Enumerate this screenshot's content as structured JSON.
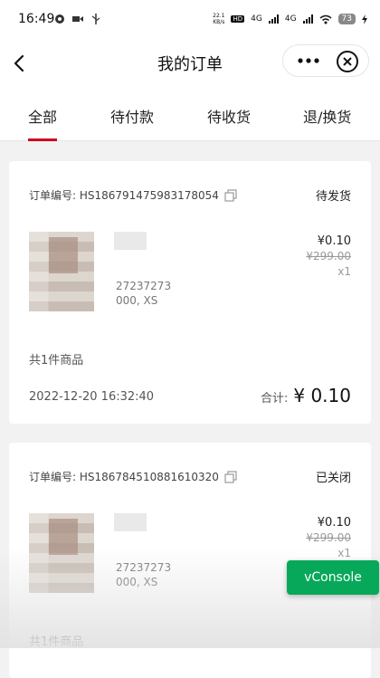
{
  "status_bar": {
    "time": "16:49",
    "net_speed_value": "22.1",
    "net_speed_unit": "KB/s",
    "hd_label": "HD",
    "signal_1": "4G",
    "signal_2": "4G",
    "battery": "73"
  },
  "nav": {
    "title": "我的订单",
    "more_label": "•••"
  },
  "tabs": [
    {
      "label": "全部",
      "active": true
    },
    {
      "label": "待付款",
      "active": false
    },
    {
      "label": "待收货",
      "active": false
    },
    {
      "label": "退/换货",
      "active": false
    }
  ],
  "orders": [
    {
      "order_no": "订单编号: HS186791475983178054",
      "status": "待发货",
      "spec_line_1": "27237273",
      "spec_line_2": "000, XS",
      "price": "¥0.10",
      "original_price": "¥299.00",
      "quantity": "x1",
      "item_count": "共1件商品",
      "time": "2022-12-20 16:32:40",
      "total_label": "合计:",
      "total_amount": "¥ 0.10"
    },
    {
      "order_no": "订单编号: HS186784510881610320",
      "status": "已关闭",
      "spec_line_1": "27237273",
      "spec_line_2": "000, XS",
      "price": "¥0.10",
      "original_price": "¥299.00",
      "quantity": "x1",
      "item_count": "共1件商品"
    }
  ],
  "vconsole_label": "vConsole",
  "colors": {
    "accent": "#d0021b",
    "vconsole": "#07a85a",
    "background": "#f2f2f2"
  }
}
